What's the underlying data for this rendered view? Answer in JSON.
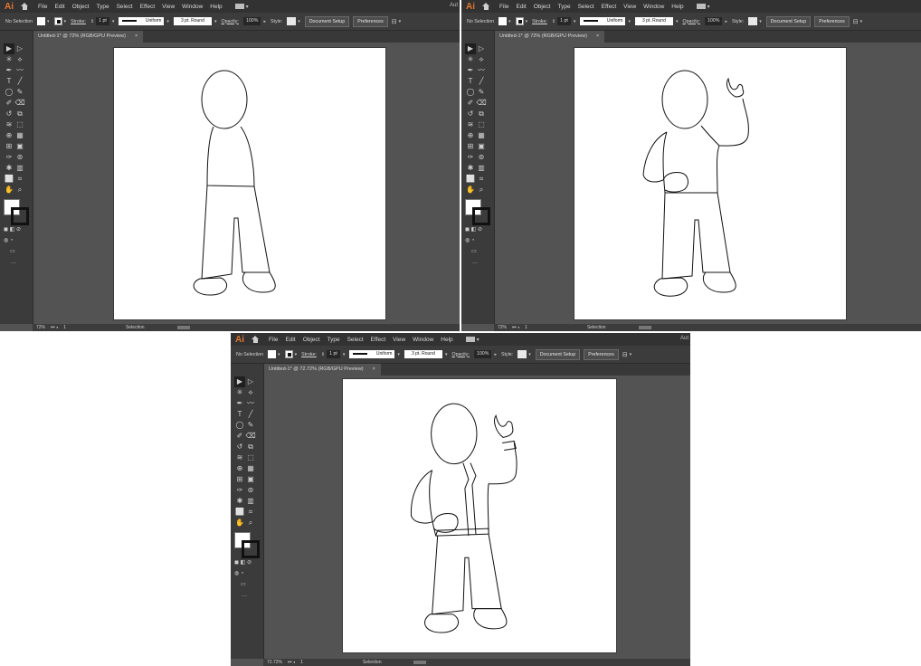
{
  "panels": [
    {
      "step": 1,
      "app_logo": "Ai",
      "corner_text": "Aut",
      "menu": [
        "File",
        "Edit",
        "Object",
        "Type",
        "Select",
        "Effect",
        "View",
        "Window",
        "Help"
      ],
      "control": {
        "selection": "No Selection",
        "stroke_label": "Stroke:",
        "stroke_weight": "1 pt",
        "stroke_profile": "Uniform",
        "brush": "3 pt. Round",
        "opacity_label": "Opacity:",
        "opacity_value": "100%",
        "style_label": "Style:",
        "document_setup": "Document Setup",
        "preferences": "Preferences"
      },
      "tab_title": "Untitled-1* @ 72% (RGB/GPU Preview)",
      "tab_close": "×",
      "status": {
        "zoom": "72%",
        "artboard": "1",
        "tool": "Selection"
      },
      "drawing": "body-outline"
    },
    {
      "step": 2,
      "app_logo": "Ai",
      "corner_text": "",
      "menu": [
        "File",
        "Edit",
        "Object",
        "Type",
        "Select",
        "Effect",
        "View",
        "Window",
        "Help"
      ],
      "control": {
        "selection": "No Selection",
        "stroke_label": "Stroke:",
        "stroke_weight": "1 pt",
        "stroke_profile": "Uniform",
        "brush": "3 pt. Round",
        "opacity_label": "Opacity:",
        "opacity_value": "100%",
        "style_label": "Style:",
        "document_setup": "Document Setup",
        "preferences": "Preferences"
      },
      "tab_title": "Untitled-1* @ 72% (RGB/GPU Preview)",
      "tab_close": "×",
      "status": {
        "zoom": "72%",
        "artboard": "1",
        "tool": "Selection"
      },
      "drawing": "arms-added"
    },
    {
      "step": 3,
      "app_logo": "Ai",
      "corner_text": "Aut",
      "menu": [
        "File",
        "Edit",
        "Object",
        "Type",
        "Select",
        "Effect",
        "View",
        "Window",
        "Help"
      ],
      "control": {
        "selection": "No Selection",
        "stroke_label": "Stroke:",
        "stroke_weight": "1 pt",
        "stroke_profile": "Uniform",
        "brush": "3 pt. Round",
        "opacity_label": "Opacity:",
        "opacity_value": "100%",
        "style_label": "Style:",
        "document_setup": "Document Setup",
        "preferences": "Preferences"
      },
      "tab_title": "Untitled-1* @ 72.72% (RGB/GPU Preview)",
      "tab_close": "×",
      "status": {
        "zoom": "72.72%",
        "artboard": "1",
        "tool": "Selection"
      },
      "drawing": "jacket-details"
    }
  ],
  "toolbar_icons": [
    "selection-tool-icon",
    "direct-selection-tool-icon",
    "magic-wand-icon",
    "lasso-icon",
    "pen-tool-icon",
    "curvature-tool-icon",
    "type-tool-icon",
    "line-segment-icon",
    "ellipse-tool-icon",
    "paintbrush-icon",
    "shaper-tool-icon",
    "eraser-icon",
    "rotate-tool-icon",
    "scale-tool-icon",
    "warp-tool-icon",
    "free-transform-icon",
    "shape-builder-icon",
    "perspective-grid-icon",
    "mesh-tool-icon",
    "gradient-tool-icon",
    "eyedropper-icon",
    "blend-tool-icon",
    "symbol-sprayer-icon",
    "column-graph-icon",
    "artboard-tool-icon",
    "slice-tool-icon",
    "hand-tool-icon",
    "zoom-tool-icon"
  ],
  "colors": {
    "app_bg": "#535353",
    "menubar": "#323232",
    "control_bar": "#3c3c3c",
    "logo": "#e0762f",
    "canvas": "#ffffff"
  }
}
